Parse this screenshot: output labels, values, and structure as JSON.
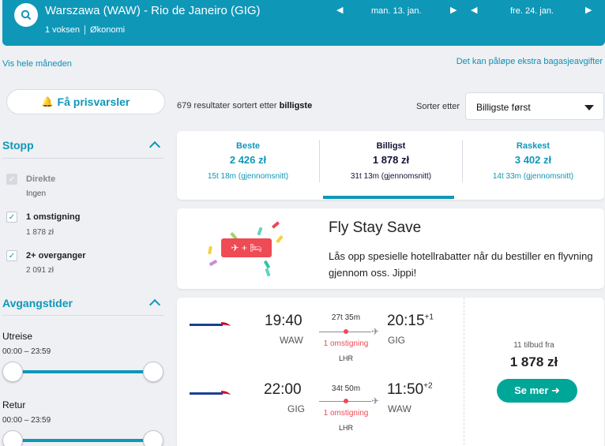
{
  "header": {
    "route": "Warszawa (WAW) - Rio de Janeiro (GIG)",
    "passengers": "1 voksen",
    "cabin": "Økonomi",
    "depart_date": "man. 13. jan.",
    "return_date": "fre. 24. jan.",
    "arrow_left": "◀",
    "arrow_right": "▶"
  },
  "links": {
    "month": "Vis hele måneden",
    "baggage": "Det kan påløpe ekstra bagasjeavgifter"
  },
  "alert": {
    "label": "Få prisvarsler",
    "icon": "bell-icon"
  },
  "results": {
    "count_text": "679 resultater sortert etter",
    "sort_key": "billigste"
  },
  "sort": {
    "label": "Sorter etter",
    "selected": "Billigste først"
  },
  "filters": {
    "stops": {
      "title": "Stopp",
      "options": [
        {
          "label": "Direkte",
          "price": "Ingen",
          "checked": true,
          "disabled": true
        },
        {
          "label": "1 omstigning",
          "price": "1 878 zł",
          "checked": true,
          "disabled": false
        },
        {
          "label": "2+ overganger",
          "price": "2 091 zł",
          "checked": true,
          "disabled": false
        }
      ]
    },
    "times": {
      "title": "Avgangstider",
      "outbound": {
        "label": "Utreise",
        "range": "00:00 – 23:59"
      },
      "return": {
        "label": "Retur",
        "range": "00:00 – 23:59"
      }
    }
  },
  "tabs": [
    {
      "label": "Beste",
      "price": "2 426 zł",
      "duration": "15t 18m (gjennomsnitt)",
      "active": false
    },
    {
      "label": "Billigst",
      "price": "1 878 zł",
      "duration": "31t 13m (gjennomsnitt)",
      "active": true
    },
    {
      "label": "Raskest",
      "price": "3 402 zł",
      "duration": "14t 33m (gjennomsnitt)",
      "active": false
    }
  ],
  "promo": {
    "title": "Fly Stay Save",
    "text": "Lås opp spesielle hotellrabatter når du bestiller en flyvning gjennom oss. Jippi!",
    "badge": "✈ + 🛏"
  },
  "flight": {
    "legs": [
      {
        "dep_time": "19:40",
        "dep_airport": "WAW",
        "arr_time": "20:15",
        "arr_offset": "+1",
        "arr_airport": "GIG",
        "duration": "27t 35m",
        "stops": "1 omstigning",
        "via": "LHR"
      },
      {
        "dep_time": "22:00",
        "dep_airport": "GIG",
        "arr_time": "11:50",
        "arr_offset": "+2",
        "arr_airport": "WAW",
        "duration": "34t 50m",
        "stops": "1 omstigning",
        "via": "LHR"
      }
    ],
    "offers": "11 tilbud fra",
    "price": "1 878 zł",
    "button": "Se mer ➜",
    "brand_colors": {
      "accent": "#0f97b8",
      "cta": "#00a698",
      "stops": "#ee4b55"
    }
  }
}
